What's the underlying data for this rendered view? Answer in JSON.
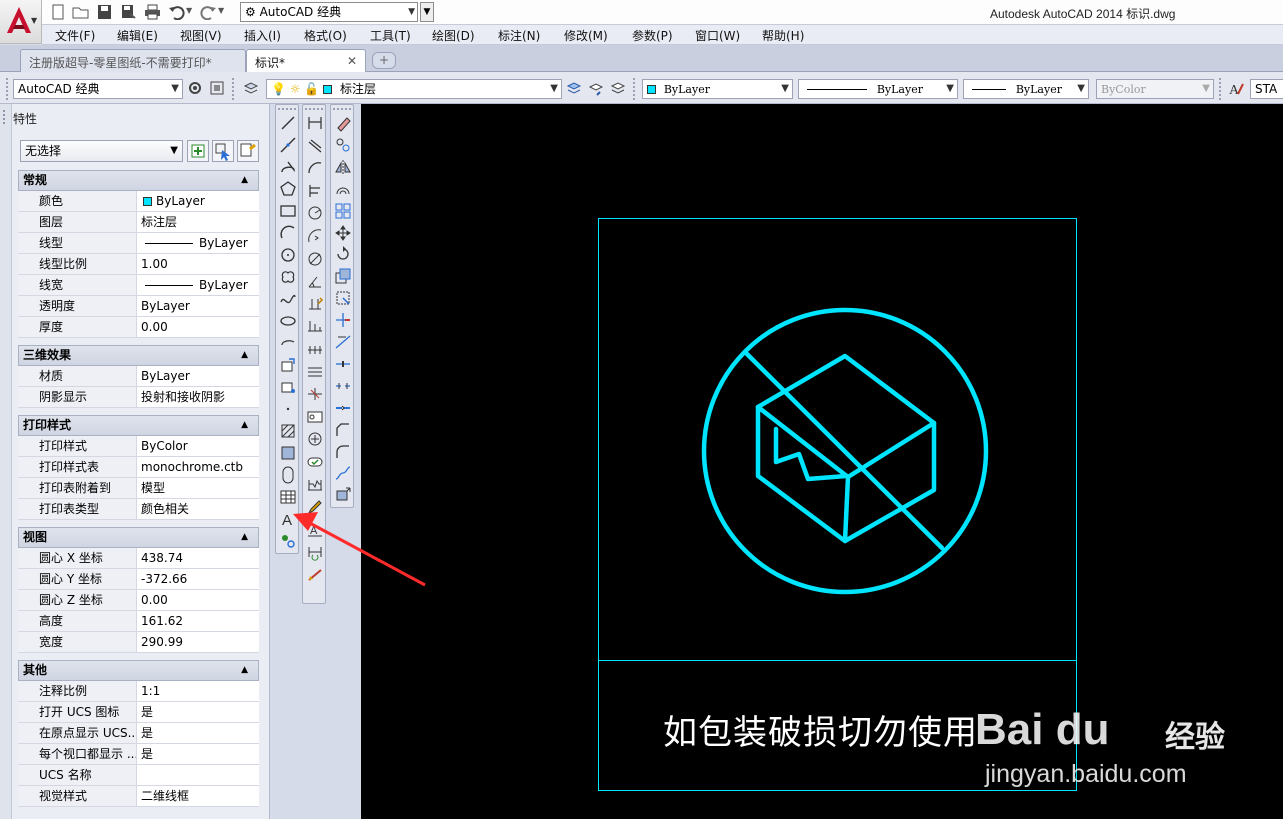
{
  "title_bar": {
    "workspace": "AutoCAD 经典",
    "app_title": "Autodesk AutoCAD 2014    标识.dwg"
  },
  "menu": [
    "文件(F)",
    "编辑(E)",
    "视图(V)",
    "插入(I)",
    "格式(O)",
    "工具(T)",
    "绘图(D)",
    "标注(N)",
    "修改(M)",
    "参数(P)",
    "窗口(W)",
    "帮助(H)"
  ],
  "tabs": [
    {
      "label": "注册版超导-零星图纸-不需要打印*",
      "active": false
    },
    {
      "label": "标识*",
      "active": true
    }
  ],
  "toolbar": {
    "workspace": "AutoCAD 经典",
    "layer": "标注层",
    "color": "ByLayer",
    "linetype": "ByLayer",
    "lineweight": "ByLayer",
    "plotstyle": "ByColor",
    "textstyle": "STA"
  },
  "properties": {
    "title": "特性",
    "selection": "无选择",
    "sections": [
      {
        "title": "常规",
        "rows": [
          {
            "key": "颜色",
            "value": "ByLayer",
            "swatch": "#00e5ff"
          },
          {
            "key": "图层",
            "value": "标注层"
          },
          {
            "key": "线型",
            "value": "ByLayer",
            "line": true
          },
          {
            "key": "线型比例",
            "value": "1.00"
          },
          {
            "key": "线宽",
            "value": "ByLayer",
            "line": true
          },
          {
            "key": "透明度",
            "value": "ByLayer"
          },
          {
            "key": "厚度",
            "value": "0.00"
          }
        ]
      },
      {
        "title": "三维效果",
        "rows": [
          {
            "key": "材质",
            "value": "ByLayer"
          },
          {
            "key": "阴影显示",
            "value": "投射和接收阴影"
          }
        ]
      },
      {
        "title": "打印样式",
        "rows": [
          {
            "key": "打印样式",
            "value": "ByColor"
          },
          {
            "key": "打印样式表",
            "value": "monochrome.ctb"
          },
          {
            "key": "打印表附着到",
            "value": "模型"
          },
          {
            "key": "打印表类型",
            "value": "颜色相关"
          }
        ]
      },
      {
        "title": "视图",
        "rows": [
          {
            "key": "圆心 X 坐标",
            "value": "438.74"
          },
          {
            "key": "圆心 Y 坐标",
            "value": "-372.66"
          },
          {
            "key": "圆心 Z 坐标",
            "value": "0.00"
          },
          {
            "key": "高度",
            "value": "161.62"
          },
          {
            "key": "宽度",
            "value": "290.99"
          }
        ]
      },
      {
        "title": "其他",
        "rows": [
          {
            "key": "注释比例",
            "value": "1:1"
          },
          {
            "key": "打开 UCS 图标",
            "value": "是"
          },
          {
            "key": "在原点显示 UCS...",
            "value": "是"
          },
          {
            "key": "每个视口都显示 ...",
            "value": "是"
          },
          {
            "key": "UCS 名称",
            "value": ""
          },
          {
            "key": "视觉样式",
            "value": "二维线框"
          }
        ]
      }
    ]
  },
  "drawing": {
    "sign_text": "如包装破损切勿使用",
    "stroke_color": "#00e5ff",
    "background": "#000000"
  },
  "watermark": {
    "brand": "Bai du",
    "product": "经验",
    "url": "jingyan.baidu.com"
  },
  "annotation": {
    "arrow_color": "#ff2a2a",
    "points_to": "text-tool-icon"
  },
  "icons": {
    "draw_toolbar": [
      "line-icon",
      "construction-line-icon",
      "polyline-icon",
      "polygon-icon",
      "rectangle-icon",
      "arc-icon",
      "circle-icon",
      "revision-cloud-icon",
      "spline-icon",
      "ellipse-icon",
      "ellipse-arc-icon",
      "insert-block-icon",
      "make-block-icon",
      "point-icon",
      "hatch-icon",
      "gradient-icon",
      "region-icon",
      "table-icon",
      "multiline-text-icon",
      "add-selected-icon"
    ],
    "dimension_toolbar": [
      "linear-dim-icon",
      "aligned-dim-icon",
      "arc-length-icon",
      "ordinate-dim-icon",
      "radius-dim-icon",
      "jogged-dim-icon",
      "diameter-dim-icon",
      "angular-dim-icon",
      "quick-dim-icon",
      "baseline-dim-icon",
      "continue-dim-icon",
      "dim-space-icon",
      "dim-break-icon",
      "tolerance-icon",
      "center-mark-icon",
      "inspection-icon",
      "jogged-linear-icon",
      "dim-edit-icon",
      "dim-text-edit-icon",
      "dim-update-icon",
      "dim-style-icon"
    ],
    "modify_toolbar": [
      "erase-icon",
      "copy-icon",
      "mirror-icon",
      "offset-icon",
      "array-icon",
      "move-icon",
      "rotate-icon",
      "scale-icon",
      "stretch-icon",
      "trim-icon",
      "extend-icon",
      "break-at-point-icon",
      "break-icon",
      "join-icon",
      "chamfer-icon",
      "fillet-icon",
      "blend-icon",
      "explode-icon"
    ]
  }
}
